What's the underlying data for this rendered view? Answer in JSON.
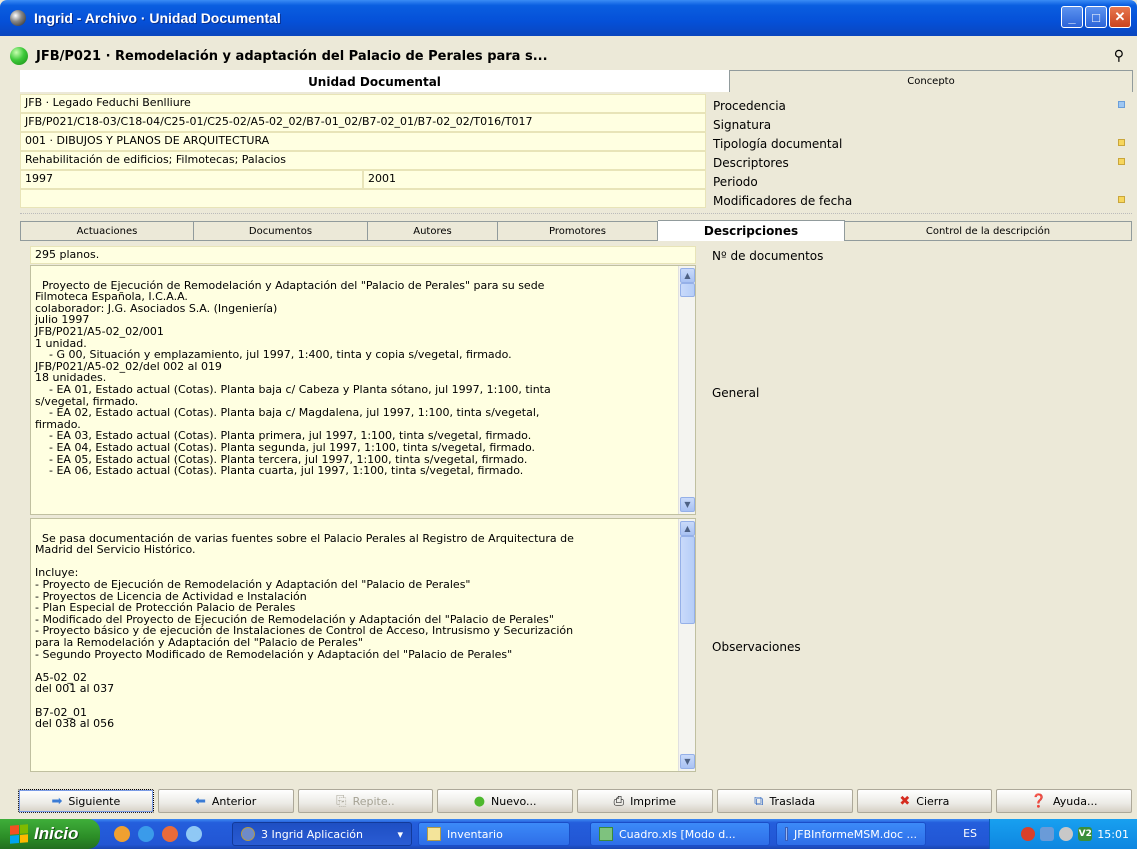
{
  "window": {
    "title": "Ingrid - Archivo · Unidad Documental",
    "buttons": [
      "_",
      "□",
      "X"
    ]
  },
  "header": {
    "title": "JFB/P021 · Remodelación y adaptación del Palacio de Perales para s...",
    "binocular_icon": "binoculars-icon"
  },
  "unidad": {
    "section_title": "Unidad Documental",
    "procedencia": "JFB · Legado Feduchi Benlliure",
    "signatura": "JFB/P021/C18-03/C18-04/C25-01/C25-02/A5-02_02/B7-01_02/B7-02_01/B7-02_02/T016/T017",
    "tipologia": "001 · DIBUJOS Y PLANOS DE ARQUITECTURA",
    "descriptores": "Rehabilitación de edificios; Filmotecas; Palacios",
    "periodo_inicio": "1997",
    "periodo_fin": "2001",
    "modificadores": ""
  },
  "concepto": {
    "tab_label": "Concepto",
    "items": [
      "Procedencia",
      "Signatura",
      "Tipología documental",
      "Descriptores",
      "Periodo",
      "Modificadores de fecha"
    ]
  },
  "tabs": [
    "Actuaciones",
    "Documentos",
    "Autores",
    "Promotores",
    "Descripciones",
    "Control de la descripción"
  ],
  "active_tab": "Descripciones",
  "descripciones": {
    "num_documentos": "295 planos.",
    "general": "Proyecto de Ejecución de Remodelación y Adaptación del \"Palacio de Perales\" para su sede\nFilmoteca Española, I.C.A.A.\ncolaborador: J.G. Asociados S.A. (Ingeniería)\njulio 1997\nJFB/P021/A5-02_02/001\n1 unidad.\n    - G 00, Situación y emplazamiento, jul 1997, 1:400, tinta y copia s/vegetal, firmado.\nJFB/P021/A5-02_02/del 002 al 019\n18 unidades.\n    - EA 01, Estado actual (Cotas). Planta baja c/ Cabeza y Planta sótano, jul 1997, 1:100, tinta\ns/vegetal, firmado.\n    - EA 02, Estado actual (Cotas). Planta baja c/ Magdalena, jul 1997, 1:100, tinta s/vegetal,\nfirmado.\n    - EA 03, Estado actual (Cotas). Planta primera, jul 1997, 1:100, tinta s/vegetal, firmado.\n    - EA 04, Estado actual (Cotas). Planta segunda, jul 1997, 1:100, tinta s/vegetal, firmado.\n    - EA 05, Estado actual (Cotas). Planta tercera, jul 1997, 1:100, tinta s/vegetal, firmado.\n    - EA 06, Estado actual (Cotas). Planta cuarta, jul 1997, 1:100, tinta s/vegetal, firmado.",
    "observaciones": "Se pasa documentación de varias fuentes sobre el Palacio Perales al Registro de Arquitectura de\nMadrid del Servicio Histórico.\n\nIncluye:\n- Proyecto de Ejecución de Remodelación y Adaptación del \"Palacio de Perales\"\n- Proyectos de Licencia de Actividad e Instalación\n- Plan Especial de Protección Palacio de Perales\n- Modificado del Proyecto de Ejecución de Remodelación y Adaptación del \"Palacio de Perales\"\n- Proyecto básico y de ejecución de Instalaciones de Control de Acceso, Intrusismo y Securización\npara la Remodelación y Adaptación del \"Palacio de Perales\"\n- Segundo Proyecto Modificado de Remodelación y Adaptación del \"Palacio de Perales\"\n\nA5-02_02\ndel 001 al 037\n\nB7-02_01\ndel 038 al 056",
    "labels": {
      "num": "Nº de documentos",
      "general": "General",
      "observaciones": "Observaciones"
    }
  },
  "buttons": [
    {
      "label": "Siguiente",
      "icon": "arrow-right-icon"
    },
    {
      "label": "Anterior",
      "icon": "arrow-left-icon"
    },
    {
      "label": "Repite..",
      "icon": "repeat-icon"
    },
    {
      "label": "Nuevo...",
      "icon": "new-icon"
    },
    {
      "label": "Imprime",
      "icon": "printer-icon"
    },
    {
      "label": "Traslada",
      "icon": "move-icon"
    },
    {
      "label": "Cierra",
      "icon": "close-icon"
    },
    {
      "label": "Ayuda...",
      "icon": "help-icon"
    }
  ],
  "taskbar": {
    "start": "Inicio",
    "items": [
      "3 Ingrid Aplicación",
      "Inventario",
      "Cuadro.xls [Modo d...",
      "JFBInformeMSM.doc ..."
    ],
    "lang": "ES",
    "clock": "15:01"
  }
}
